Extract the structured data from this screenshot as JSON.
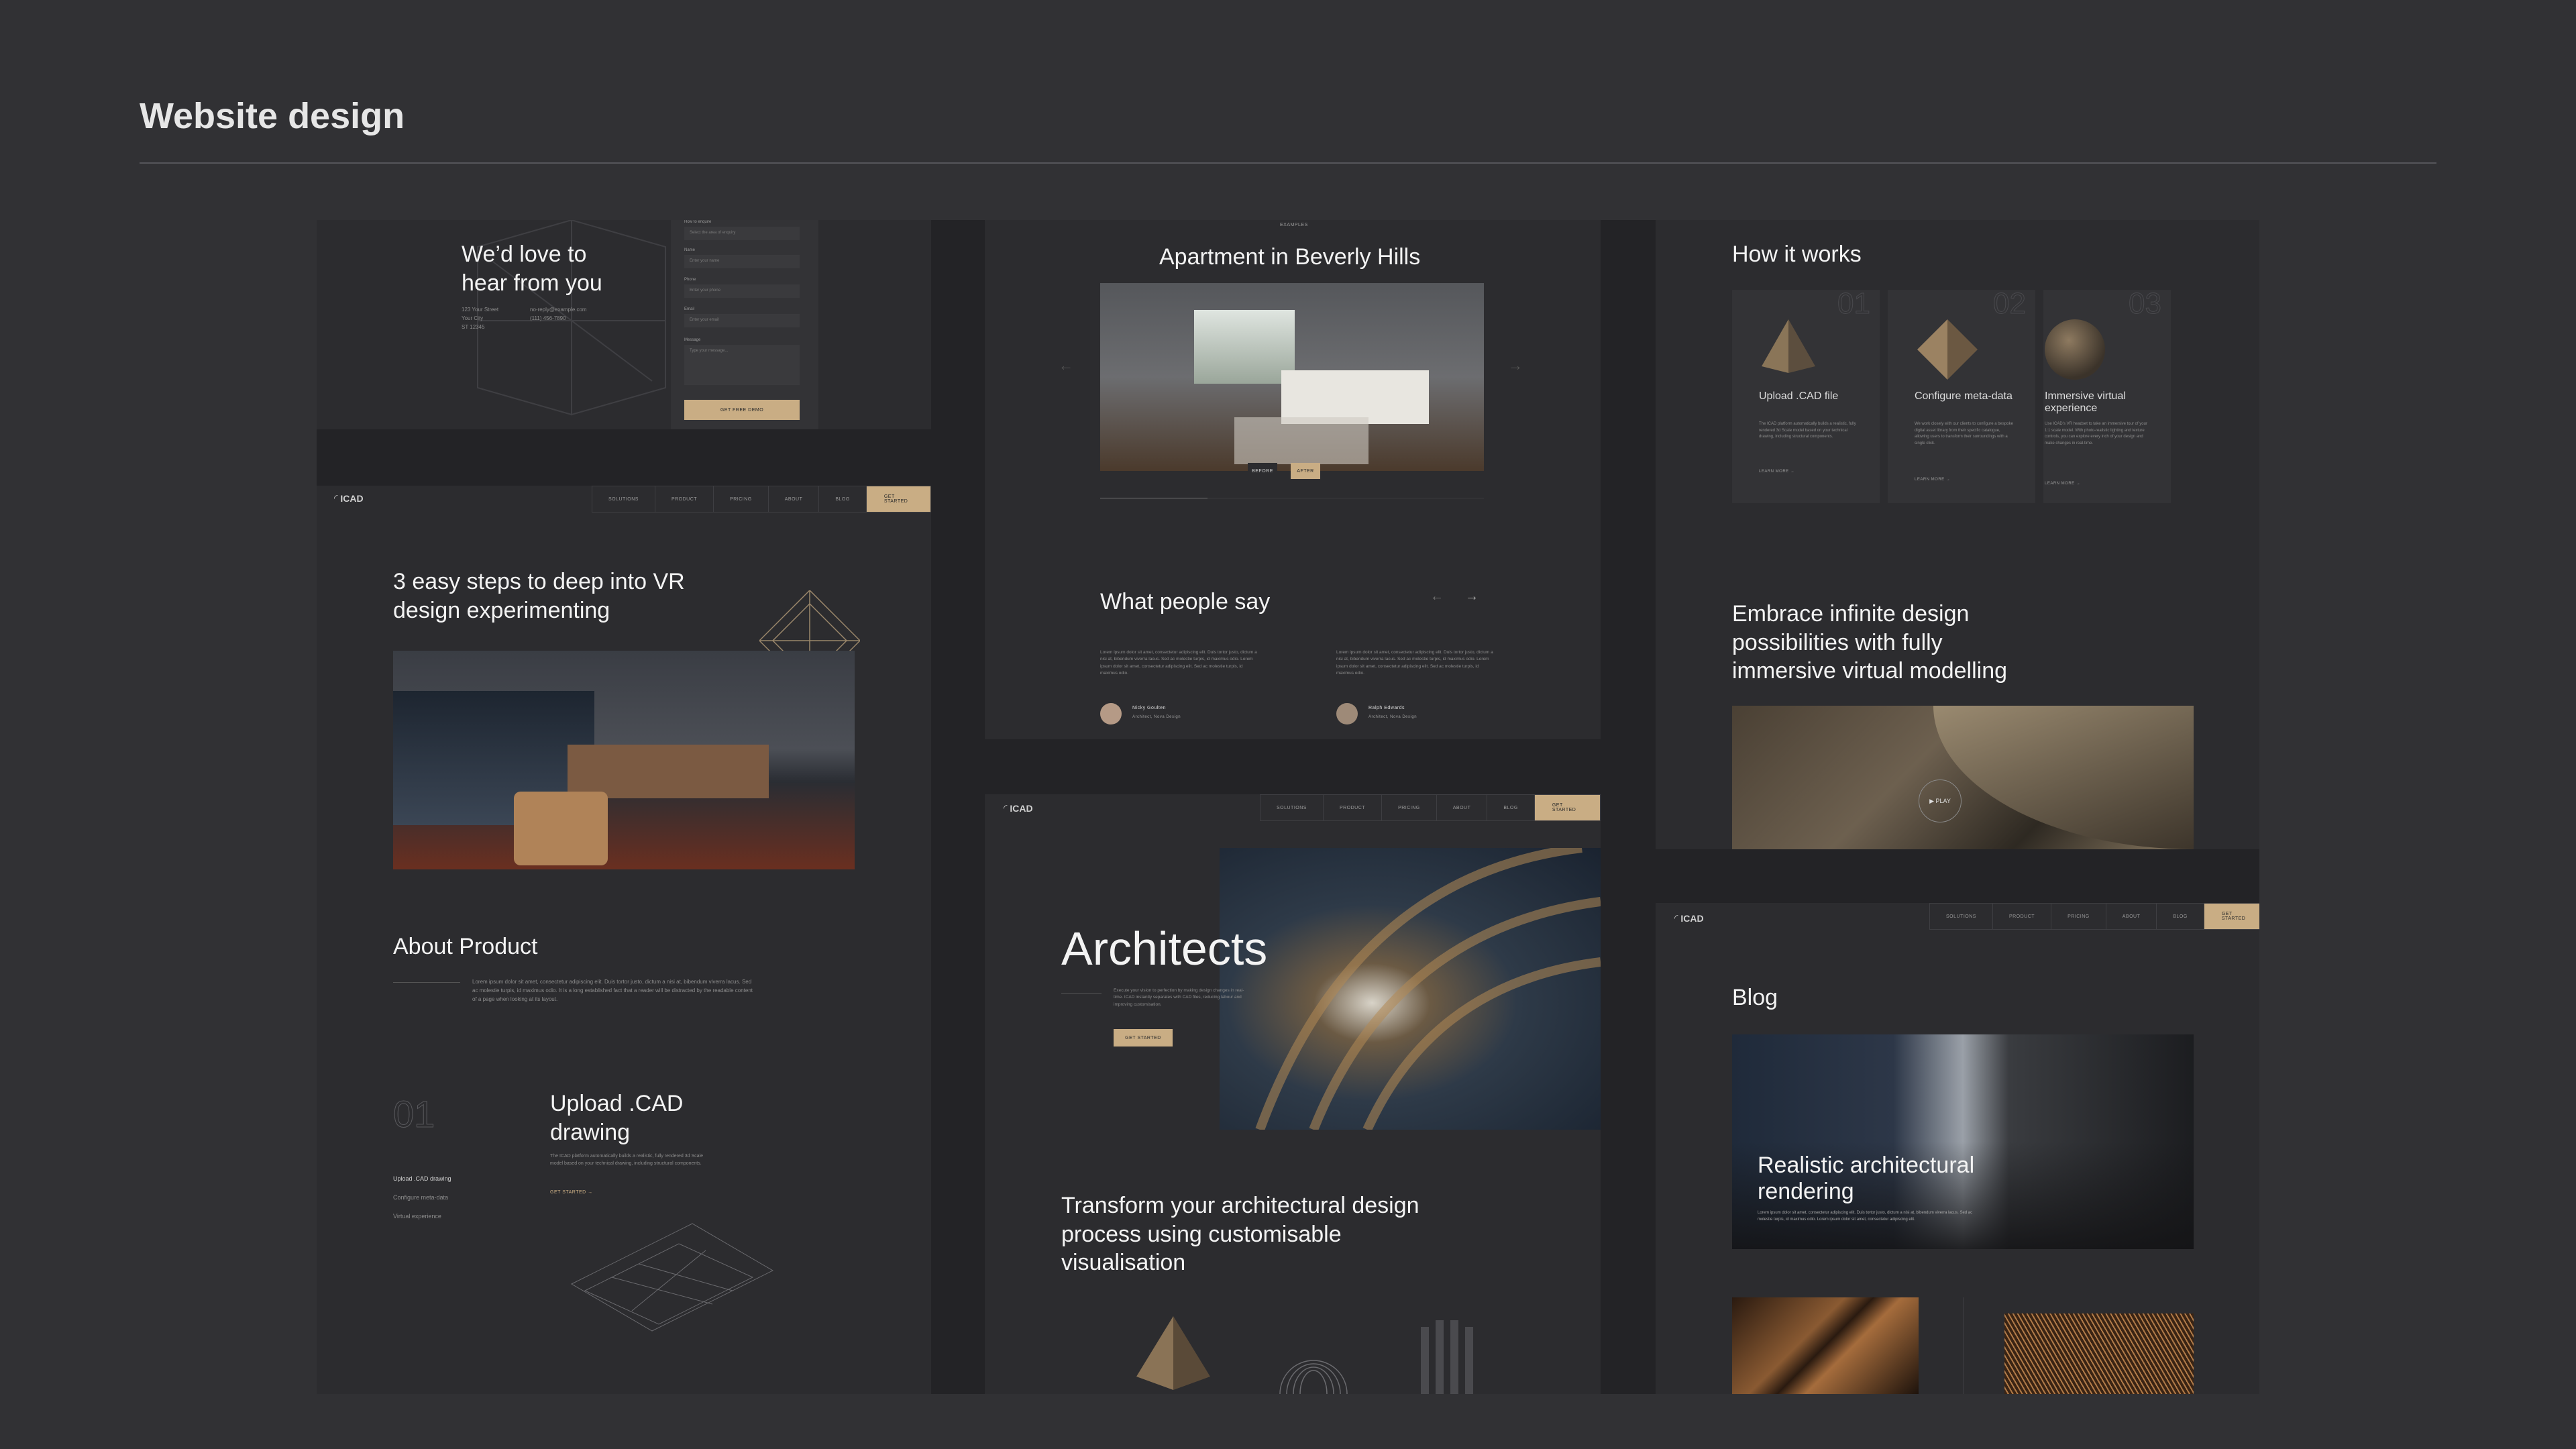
{
  "page": {
    "title": "Website design"
  },
  "contact": {
    "heading": "We’d love to hear from you",
    "address": [
      "123 Your Street",
      "Your City",
      "ST 12345"
    ],
    "email": "no-reply@example.com",
    "phone": "(111) 456-7890",
    "form_top_label": "How to enquire",
    "subject_placeholder": "Select the area of enquiry",
    "name_label": "Name",
    "name_placeholder": "Enter your name",
    "phone_label": "Phone",
    "phone_placeholder": "Enter your phone",
    "email_label": "Email",
    "email_placeholder": "Enter your email",
    "message_label": "Message",
    "message_placeholder": "Type your message...",
    "submit": "GET FREE DEMO"
  },
  "nav": {
    "logo": "ICAD",
    "items": [
      "SOLUTIONS",
      "PRODUCT",
      "PRICING",
      "ABOUT",
      "BLOG"
    ],
    "cta": "GET STARTED"
  },
  "vr": {
    "heading": "3 easy steps to deep into VR design experimenting",
    "about_heading": "About Product",
    "about_text": "Lorem ipsum dolor sit amet, consectetur adipiscing elit. Duis tortor justo, dictum a nisi at, bibendum viverra lacus. Sed ac molestie turpis, id maximus odio. It is a long established fact that a reader will be distracted by the readable content of a page when looking at its layout.",
    "step_number": "01",
    "step_heading": "Upload .CAD drawing",
    "step_text": "The ICAD platform automatically builds a realistic, fully rendered 3d Scale model based on your technical drawing, including structural components.",
    "step_link": "GET STARTED →",
    "step_list": [
      "Upload .CAD drawing",
      "Configure meta-data",
      "Virtual experience"
    ]
  },
  "examples": {
    "label": "EXAMPLES",
    "heading": "Apartment in Beverly Hills",
    "before": "BEFORE",
    "after": "AFTER",
    "testimonials_heading": "What people say",
    "quote": "Lorem ipsum dolor sit amet, consectetur adipiscing elit. Duis tortor justo, dictum a nisi at, bibendum viverra lacus. Sed ac molestie turpis, id maximus odio. Lorem ipsum dolor sit amet, consectetur adipiscing elit. Sed ac molestie turpis, id maximus odio.",
    "people": [
      {
        "name": "Nicky Goulten",
        "role": "Architect, Nova Design"
      },
      {
        "name": "Ralph Edwards",
        "role": "Architect, Nova Design"
      }
    ]
  },
  "architects": {
    "heading": "Architects",
    "text": "Execute your vision to perfection by making design changes in real-time. ICAD instantly separates with CAD files, reducing labour and improving customisation.",
    "button": "GET STARTED",
    "transform_heading": "Transform your architectural design process using customisable visualisation"
  },
  "how": {
    "heading": "How it works",
    "steps": [
      {
        "num": "01",
        "title": "Upload .CAD file",
        "text": "The ICAD platform automatically builds a realistic, fully rendered 3d Scale model based on your technical drawing, including structural components.",
        "link": "LEARN MORE →"
      },
      {
        "num": "02",
        "title": "Configure meta-data",
        "text": "We work closely with our clients to configure a bespoke digital asset library from their specific catalogue, allowing users to transform their surroundings with a single click.",
        "link": "LEARN MORE →"
      },
      {
        "num": "03",
        "title": "Immersive virtual experience",
        "text": "Use ICAD’s VR headset to take an immersive tour of your 1:1 scale model. With photo-realistic lighting and texture controls, you can explore every inch of your design and make changes in real-time.",
        "link": "LEARN MORE →"
      }
    ],
    "embrace_heading": "Embrace infinite design possibilities with fully immersive virtual modelling",
    "play": "PLAY"
  },
  "blog": {
    "heading": "Blog",
    "feature_title": "Realistic architectural rendering",
    "feature_text": "Lorem ipsum dolor sit amet, consectetur adipiscing elit. Duis tortor justo, dictum a nisi at, bibendum viverra lacus. Sed ac molestie turpis, id maximus odio. Lorem ipsum dolor sit amet, consectetur adipiscing elit."
  }
}
